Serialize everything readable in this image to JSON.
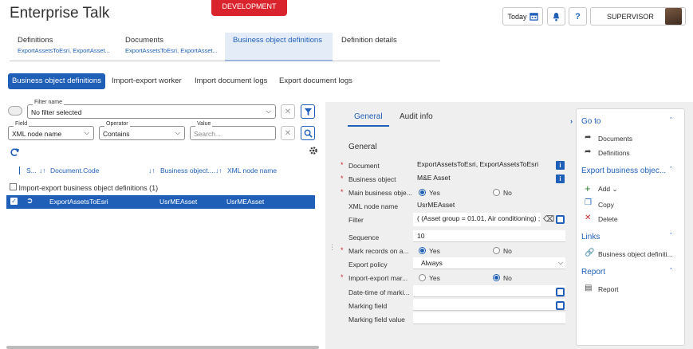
{
  "app": {
    "title": "Enterprise Talk",
    "environment": "DEVELOPMENT",
    "today_label": "Today",
    "user": "SUPERVISOR",
    "help_label": "?"
  },
  "tabs": [
    {
      "label": "Definitions",
      "sub": "ExportAssetsToEsri, ExportAsset..."
    },
    {
      "label": "Documents",
      "sub": "ExportAssetsToEsri, ExportAsset..."
    },
    {
      "label": "Business object definitions",
      "sub": ""
    },
    {
      "label": "Definition details",
      "sub": ""
    }
  ],
  "subtabs": [
    "Business object definitions",
    "Import-export worker",
    "Import document logs",
    "Export document logs"
  ],
  "filter": {
    "filter_name_label": "Filter name",
    "filter_name_value": "No filter selected",
    "field_label": "Field",
    "field_value": "XML node name",
    "operator_label": "Operator",
    "operator_value": "Contains",
    "value_label": "Value",
    "value_placeholder": "Search..."
  },
  "table": {
    "headers": [
      "S...",
      "Document.Code",
      "Business object....",
      "XML node name"
    ],
    "group_label": "Import-export business object definitions (1)",
    "rows": [
      {
        "code": "ExportAssetsToEsri",
        "bo": "UsrMEAsset",
        "xml": "UsrMEAsset"
      }
    ]
  },
  "detail": {
    "tabs": [
      "General",
      "Audit info"
    ],
    "section": "General",
    "fields": {
      "document_label": "Document",
      "document_value": "ExportAssetsToEsri, ExportAssetsToEsri",
      "bo_label": "Business object",
      "bo_value": "M&E Asset",
      "main_bo_label": "Main business obje...",
      "yes": "Yes",
      "no": "No",
      "xml_label": "XML node name",
      "xml_value": "UsrMEAsset",
      "filter_label": "Filter",
      "filter_value": "( (Asset group = 01.01, Air conditioning) ;",
      "sequence_label": "Sequence",
      "sequence_value": "10",
      "mark_label": "Mark records on a...",
      "export_policy_label": "Export policy",
      "export_policy_value": "Always",
      "ie_mark_label": "Import-export mar...",
      "datetime_label": "Date-time of marki...",
      "marking_field_label": "Marking field",
      "marking_value_label": "Marking field value"
    }
  },
  "side": {
    "goto": "Go to",
    "goto_items": [
      "Documents",
      "Definitions"
    ],
    "export": "Export business objec...",
    "export_items": [
      "Add",
      "Copy",
      "Delete"
    ],
    "links": "Links",
    "links_items": [
      "Business object definiti..."
    ],
    "report": "Report",
    "report_items": [
      "Report"
    ]
  },
  "colors": {
    "accent": "#1f5fb8",
    "env": "#d9232d"
  }
}
